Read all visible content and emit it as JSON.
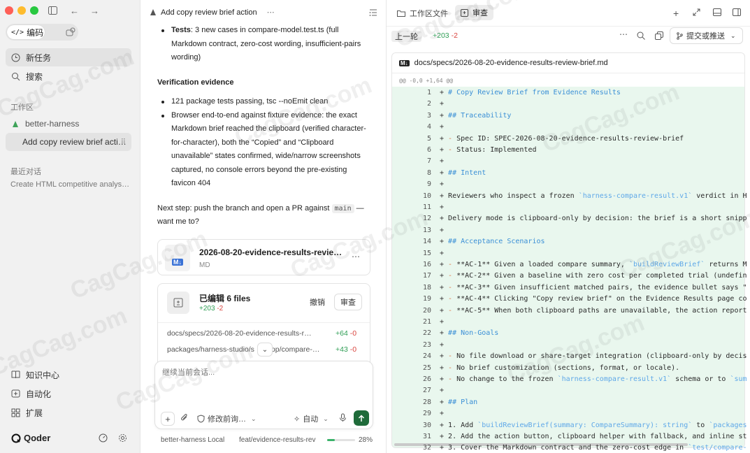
{
  "sidebar": {
    "mode_label": "编码",
    "new_task": "新任务",
    "search": "搜索",
    "workspace_heading": "工作区",
    "workspace_name": "better-harness",
    "active_thread": "Add copy review brief acti…",
    "recent_heading": "最近对话",
    "recent_item": "Create HTML competitive analys…",
    "bottom": {
      "knowledge": "知识中心",
      "automation": "自动化",
      "extensions": "扩展",
      "brand": "Qoder"
    }
  },
  "chat": {
    "title": "Add copy review brief action",
    "tests_label": "Tests",
    "tests_text_1": ": 3 new cases in compare-model.test.ts (full",
    "tests_text_2": "Markdown contract, zero-cost wording, insufficient-pairs",
    "tests_text_3": "wording)",
    "verification_heading": "Verification evidence",
    "v1": "121 package tests passing, tsc --noEmit clean",
    "v2_lines": [
      "Browser end-to-end against fixture evidence: the exact",
      "Markdown brief reached the clipboard (verified character-",
      "for-character), both the “Copied” and “Clipboard",
      "unavailable” states confirmed, wide/narrow screenshots",
      "captured, no console errors beyond the pre-existing",
      "favicon 404"
    ],
    "next_step_1": "Next step: push the branch and open a PR against",
    "next_step_branch": "main",
    "next_step_dash": "—",
    "next_step_2": "want me to?",
    "file_card": {
      "name": "2026-08-20-evidence-results-revie…",
      "type": "MD",
      "badge": "M↓"
    },
    "edit_card": {
      "title": "已编辑 6 files",
      "added": "+203",
      "removed": "-2",
      "undo": "撤销",
      "review": "审查",
      "files": [
        {
          "path": "docs/specs/2026-08-20-evidence-results-r…",
          "added": "+64",
          "removed": "-0"
        },
        {
          "path": "packages/harness-studio/s",
          "path2": "pp/compare-…",
          "added": "+43",
          "removed": "-0"
        }
      ]
    },
    "input_placeholder": "继续当前会话...",
    "mode_select": "修改前询…",
    "auto_select": "自动",
    "status_repo": "better-harness Local",
    "status_branch": "feat/evidence-results-rev",
    "status_pct": "28%",
    "status_progress": 0.28
  },
  "diff": {
    "tab_files": "工作区文件",
    "tab_review": "审查",
    "prev_round": "上一轮",
    "added": "+203",
    "removed": "-2",
    "commit_btn": "提交或推送",
    "file_path": "docs/specs/2026-08-20-evidence-results-review-brief.md",
    "hunk": "@@ -0,0 +1,64 @@",
    "lines": [
      {
        "n": "1",
        "t": "+ # Copy Review Brief from Evidence Results",
        "k": "h"
      },
      {
        "n": "2",
        "t": "+",
        "k": "b"
      },
      {
        "n": "3",
        "t": "+ ## Traceability",
        "k": "h"
      },
      {
        "n": "4",
        "t": "+",
        "k": "b"
      },
      {
        "n": "5",
        "t": "+ - Spec ID: SPEC-2026-08-20-evidence-results-review-brief",
        "k": "b"
      },
      {
        "n": "6",
        "t": "+ - Status: Implemented",
        "k": "b"
      },
      {
        "n": "7",
        "t": "+",
        "k": "b"
      },
      {
        "n": "8",
        "t": "+ ## Intent",
        "k": "h"
      },
      {
        "n": "9",
        "t": "+",
        "k": "b"
      },
      {
        "n": "10",
        "t": "+ Reviewers who inspect a frozen `harness-compare-result.v1` verdict in Ha",
        "k": "b"
      },
      {
        "n": "11",
        "t": "+",
        "k": "b"
      },
      {
        "n": "12",
        "t": "+ Delivery mode is clipboard-only by decision: the brief is a short snippe",
        "k": "b"
      },
      {
        "n": "13",
        "t": "+",
        "k": "b"
      },
      {
        "n": "14",
        "t": "+ ## Acceptance Scenarios",
        "k": "h"
      },
      {
        "n": "15",
        "t": "+",
        "k": "b"
      },
      {
        "n": "16",
        "t": "+ - **AC-1** Given a loaded compare summary, `buildReviewBrief` returns Ma",
        "k": "b"
      },
      {
        "n": "17",
        "t": "+ - **AC-2** Given a baseline with zero cost per completed trial (undefine",
        "k": "b"
      },
      {
        "n": "18",
        "t": "+ - **AC-3** Given insufficient matched pairs, the evidence bullet says \"n",
        "k": "b"
      },
      {
        "n": "19",
        "t": "+ - **AC-4** Clicking \"Copy review brief\" on the Evidence Results page cop",
        "k": "b"
      },
      {
        "n": "20",
        "t": "+ - **AC-5** When both clipboard paths are unavailable, the action reports",
        "k": "b"
      },
      {
        "n": "21",
        "t": "+",
        "k": "b"
      },
      {
        "n": "22",
        "t": "+ ## Non-Goals",
        "k": "h"
      },
      {
        "n": "23",
        "t": "+",
        "k": "b"
      },
      {
        "n": "24",
        "t": "+ - No file download or share-target integration (clipboard-only by decisi",
        "k": "b"
      },
      {
        "n": "25",
        "t": "+ - No brief customization (sections, format, or locale).",
        "k": "b"
      },
      {
        "n": "26",
        "t": "+ - No change to the frozen `harness-compare-result.v1` schema or to `summ",
        "k": "b"
      },
      {
        "n": "27",
        "t": "+",
        "k": "b"
      },
      {
        "n": "28",
        "t": "+ ## Plan",
        "k": "h"
      },
      {
        "n": "29",
        "t": "+",
        "k": "b"
      },
      {
        "n": "30",
        "t": "+ 1. Add `buildReviewBrief(summary: CompareSummary): string` to `packages/",
        "k": "b"
      },
      {
        "n": "31",
        "t": "+ 2. Add the action button, clipboard helper with fallback, and inline sta",
        "k": "b"
      },
      {
        "n": "32",
        "t": "+ 3. Cover the Markdown contract and the zero-cost edge in `test/compare-m",
        "k": "b"
      }
    ]
  },
  "watermark": "CagCag.com",
  "colors": {
    "accent_green": "#2f9e55",
    "removed_red": "#d9443e",
    "diff_bg": "#e9f7ee",
    "heading_blue": "#3a8fd6"
  }
}
